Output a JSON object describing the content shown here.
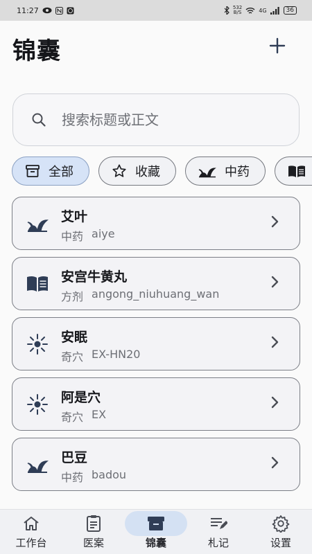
{
  "status_bar": {
    "time": "11:27",
    "net_speed": "532",
    "net_unit": "B/S",
    "signal": "4G",
    "battery": "36"
  },
  "header": {
    "title": "锦囊",
    "add_label": "+"
  },
  "search": {
    "placeholder": "搜索标题或正文"
  },
  "filters": [
    {
      "label": "全部",
      "icon": "archive-icon",
      "selected": true
    },
    {
      "label": "收藏",
      "icon": "star-icon",
      "selected": false
    },
    {
      "label": "中药",
      "icon": "herb-icon",
      "selected": false
    },
    {
      "label": "",
      "icon": "book-icon",
      "selected": false
    }
  ],
  "items": [
    {
      "title": "艾叶",
      "category": "中药",
      "code": "aiye",
      "icon": "herb-icon"
    },
    {
      "title": "安宫牛黄丸",
      "category": "方剂",
      "code": "angong_niuhuang_wan",
      "icon": "book-icon"
    },
    {
      "title": "安眠",
      "category": "奇穴",
      "code": "EX-HN20",
      "icon": "acupoint-icon"
    },
    {
      "title": "阿是穴",
      "category": "奇穴",
      "code": "EX",
      "icon": "acupoint-icon"
    },
    {
      "title": "巴豆",
      "category": "中药",
      "code": "badou",
      "icon": "herb-icon"
    }
  ],
  "bottom_nav": [
    {
      "label": "工作台",
      "icon": "home-icon",
      "active": false
    },
    {
      "label": "医案",
      "icon": "clipboard-icon",
      "active": false
    },
    {
      "label": "锦囊",
      "icon": "archive-icon",
      "active": true
    },
    {
      "label": "札记",
      "icon": "notes-icon",
      "active": false
    },
    {
      "label": "设置",
      "icon": "gear-icon",
      "active": false
    }
  ],
  "colors": {
    "accent": "#d6e3f7",
    "icon": "#2f3d56"
  }
}
